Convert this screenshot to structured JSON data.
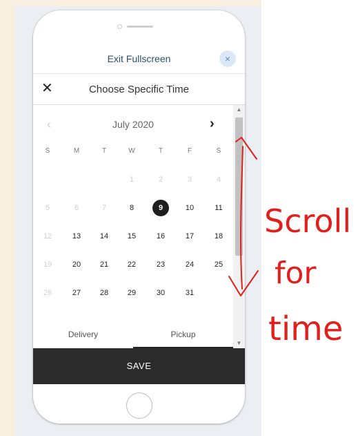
{
  "exit_fullscreen": "Exit Fullscreen",
  "exit_close_glyph": "×",
  "header": {
    "close_glyph": "✕",
    "title": "Choose Specific Time"
  },
  "calendar": {
    "month": "July 2020",
    "prev_glyph": "‹",
    "next_glyph": "›",
    "weekdays": [
      "S",
      "M",
      "T",
      "W",
      "T",
      "F",
      "S"
    ],
    "weeks": [
      [
        null,
        null,
        null,
        "1",
        "2",
        "3",
        "4"
      ],
      [
        "5",
        "6",
        "7",
        "8",
        "9",
        "10",
        "11"
      ],
      [
        "12",
        "13",
        "14",
        "15",
        "16",
        "17",
        "18"
      ],
      [
        "19",
        "20",
        "21",
        "22",
        "23",
        "24",
        "25"
      ],
      [
        "26",
        "27",
        "28",
        "29",
        "30",
        "31",
        null
      ]
    ],
    "muted_days": [
      "1",
      "2",
      "3",
      "4",
      "5",
      "6",
      "7",
      "12",
      "19",
      "26"
    ],
    "selected_day": "9"
  },
  "tabs": [
    {
      "label": "Delivery",
      "active": false
    },
    {
      "label": "Pickup",
      "active": true
    }
  ],
  "scrollbar": {
    "up_glyph": "▲",
    "down_glyph": "▼"
  },
  "save_label": "SAVE",
  "annotation": {
    "text_lines": [
      "Scroll",
      "for",
      "time"
    ],
    "color": "#e0201c"
  }
}
